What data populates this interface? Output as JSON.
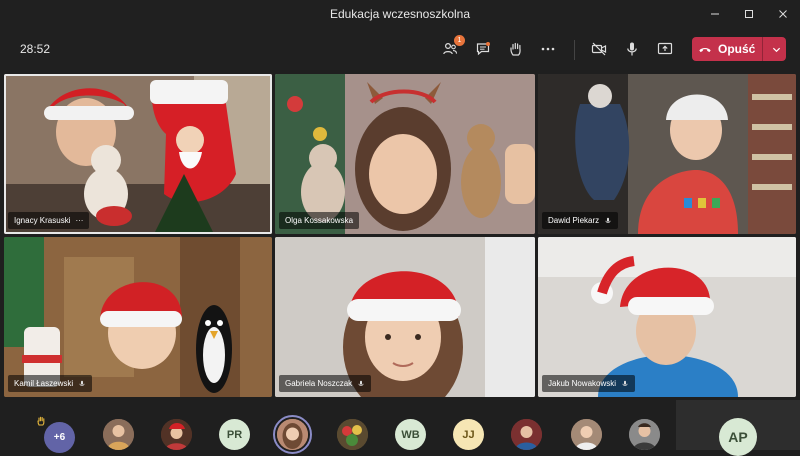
{
  "window": {
    "title": "Edukacja wczesnoszkolna"
  },
  "toolbar": {
    "timer": "28:52",
    "participants_badge": "1",
    "leave_label": "Opuść"
  },
  "participants": [
    {
      "name": "Ignacy Krasuski",
      "more": "···"
    },
    {
      "name": "Olga Kossakowska"
    },
    {
      "name": "Dawid Piekarz"
    },
    {
      "name": "Kamil Łaszewski"
    },
    {
      "name": "Gabriela Noszczak"
    },
    {
      "name": "Jakub Nowakowski"
    }
  ],
  "roster": {
    "more_count": "+6",
    "initials": [
      "PR",
      "WB",
      "JJ"
    ],
    "self": "AP"
  }
}
